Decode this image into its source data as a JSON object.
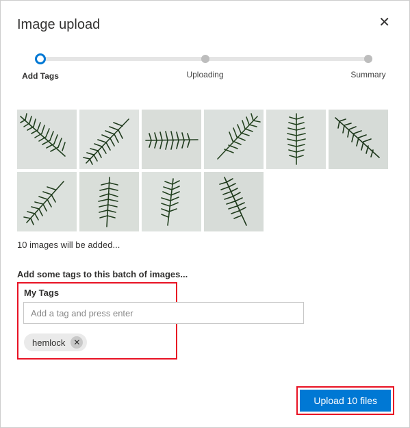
{
  "dialog": {
    "title": "Image upload"
  },
  "stepper": {
    "steps": [
      {
        "label": "Add Tags"
      },
      {
        "label": "Uploading"
      },
      {
        "label": "Summary"
      }
    ]
  },
  "thumbs": {
    "count": 10,
    "status": "10 images will be added..."
  },
  "tags": {
    "prompt": "Add some tags to this batch of images...",
    "section_label": "My Tags",
    "input_placeholder": "Add a tag and press enter",
    "chips": [
      {
        "name": "hemlock"
      }
    ]
  },
  "footer": {
    "upload_label": "Upload 10 files"
  }
}
